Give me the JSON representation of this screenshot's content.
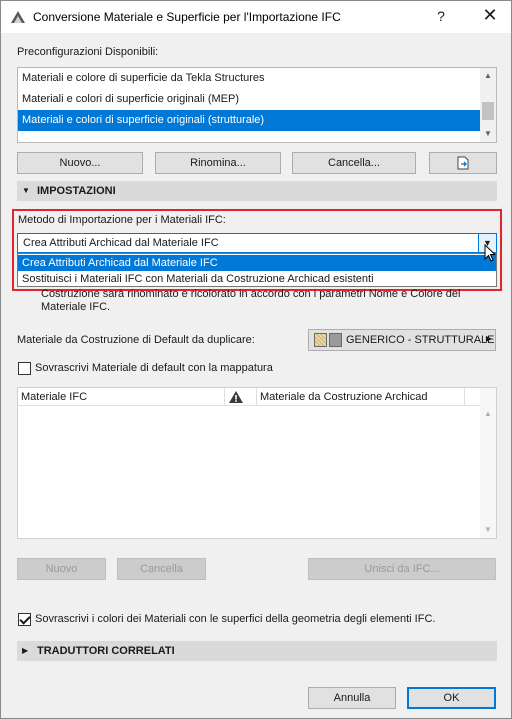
{
  "window": {
    "title": "Conversione Materiale e Superficie per l'Importazione IFC",
    "help_glyph": "?",
    "close_glyph": "✕"
  },
  "presets": {
    "label": "Preconfigurazioni Disponibili:",
    "items": [
      "Materiali e colore di superficie da Tekla Structures",
      "Materiali e colori di superficie originali (MEP)",
      "Materiali e colori di superficie originali (strutturale)"
    ],
    "selected_index": 2
  },
  "preset_buttons": {
    "new": "Nuovo...",
    "rename": "Rinomina...",
    "delete": "Cancella..."
  },
  "settings": {
    "header": "IMPOSTAZIONI",
    "method_label": "Metodo di Importazione per i Materiali IFC:",
    "method_value": "Crea Attributi Archicad dal Materiale IFC",
    "method_options": [
      "Crea Attributi Archicad dal Materiale IFC",
      "Sostituisci i Materiali IFC con Materiali da Costruzione Archicad esistenti"
    ],
    "description": "Costruzione sarà rinominato e ricolorato in accordo con i parametri Nome e Colore del Materiale IFC.",
    "default_material_label": "Materiale da Costruzione di Default da duplicare:",
    "default_material_value": "GENERICO - STRUTTURALE",
    "overwrite_default_label": "Sovrascrivi Materiale di default con la mappatura",
    "overwrite_default_checked": false
  },
  "mapping_table": {
    "col1": "Materiale IFC",
    "col2": "Materiale da Costruzione Archicad",
    "warning_icon": "warning-icon",
    "rows": []
  },
  "table_buttons": {
    "new": "Nuovo",
    "delete": "Cancella",
    "merge": "Unisci da IFC..."
  },
  "overwrite_colors": {
    "label": "Sovrascrivi i colori dei Materiali con le superfici della geometria degli elementi IFC.",
    "checked": true
  },
  "related_translators": {
    "header": "TRADUTTORI CORRELATI"
  },
  "footer": {
    "cancel": "Annulla",
    "ok": "OK"
  },
  "colors": {
    "selection": "#0078d7",
    "highlight_border": "#e0262b",
    "section_bg": "#dadada"
  }
}
